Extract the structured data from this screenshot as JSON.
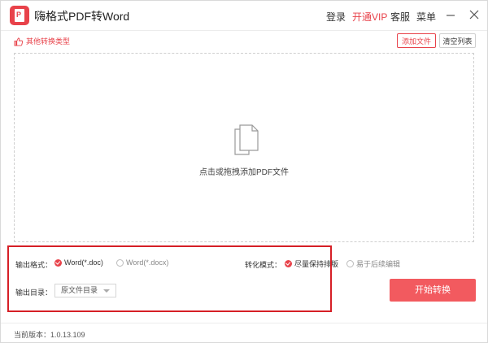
{
  "app": {
    "title": "嗨格式PDF转Word",
    "logo_letter": "P",
    "accent_color": "#e8424a"
  },
  "header": {
    "links": [
      {
        "label": "登录",
        "icon": ""
      },
      {
        "label": "开通VIP",
        "icon": ""
      },
      {
        "label": "客服",
        "icon": ""
      },
      {
        "label": "菜单",
        "icon": ""
      }
    ],
    "window_buttons": [
      "minimize-icon",
      "close-icon"
    ]
  },
  "toolbar": {
    "other_types_label": "其他转换类型",
    "other_types_icon": "thumbs-up-icon",
    "add_file_label": "添加文件",
    "clear_list_label": "清空列表"
  },
  "dropzone": {
    "icon": "file-stack-icon",
    "text": "点击或拖拽添加PDF文件"
  },
  "options": {
    "output_format_label": "输出格式：",
    "format_options": [
      {
        "label": "Word(*.doc)",
        "selected": true
      },
      {
        "label": "Word(*.docx)",
        "selected": false
      }
    ],
    "convert_mode_label": "转化模式：",
    "mode_options": [
      {
        "label": "尽量保持排版",
        "selected": true
      },
      {
        "label": "易于后续编辑",
        "selected": false
      }
    ],
    "output_dir_label": "输出目录：",
    "output_dir_value": "原文件目录"
  },
  "actions": {
    "start_label": "开始转换"
  },
  "footer": {
    "version_text": "当前版本：1.0.13.109"
  }
}
